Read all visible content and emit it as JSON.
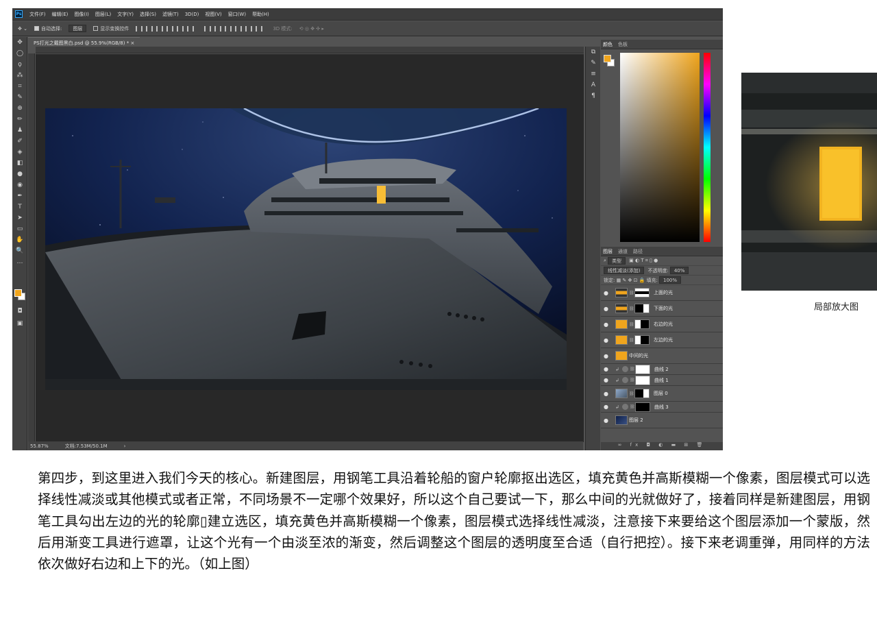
{
  "ps": {
    "menus": [
      "文件(F)",
      "编辑(E)",
      "图像(I)",
      "图层(L)",
      "文字(Y)",
      "选择(S)",
      "滤镜(T)",
      "3D(D)",
      "视图(V)",
      "窗口(W)",
      "帮助(H)"
    ],
    "options": {
      "auto_select_label": "自动选择:",
      "auto_select_value": "图层",
      "show_transform_label": "显示变换控件",
      "mode_3d_label": "3D 模式:"
    },
    "tools": [
      "✥",
      "◯",
      "ϙ",
      "⁂",
      "⌗",
      "✎",
      "⊕",
      "✏",
      "♟",
      "✐",
      "◈",
      "◧",
      "●",
      "◉",
      "✒",
      "T",
      "➤",
      "▭",
      "✋",
      "🔍",
      "…"
    ],
    "doc_tab": "PS打光之戴图黑白.psd @ 55.9%(RGB/8) *",
    "status": {
      "zoom": "55.87%",
      "doc": "文档:7.53M/50.1M"
    },
    "color_panel": {
      "tabs": [
        "颜色",
        "色板"
      ],
      "fg": "#f0a51d",
      "bg": "#ffffff"
    },
    "layers_panel": {
      "tabs": [
        "图层",
        "通道",
        "路径"
      ],
      "filter_kind": "类型",
      "blend_mode": "线性减淡(添加)",
      "opacity_label": "不透明度:",
      "opacity_value": "40%",
      "lock_label": "锁定:",
      "fill_label": "填充:",
      "fill_value": "100%",
      "layers": [
        {
          "name": "上面的光",
          "thumb": "strip",
          "mask": "bar",
          "kind": "normal"
        },
        {
          "name": "下面的光",
          "thumb": "strip",
          "mask": "dark",
          "kind": "normal"
        },
        {
          "name": "右边的光",
          "thumb": "yellow",
          "mask": "darkr",
          "kind": "normal"
        },
        {
          "name": "左边的光",
          "thumb": "yellow",
          "mask": "darkr",
          "kind": "normal"
        },
        {
          "name": "中间的光",
          "thumb": "yellow",
          "mask": "",
          "kind": "normal"
        },
        {
          "name": "曲线 2",
          "thumb": "adj",
          "mask": "white",
          "kind": "adj"
        },
        {
          "name": "曲线 1",
          "thumb": "adj",
          "mask": "white",
          "kind": "adj"
        },
        {
          "name": "图层 0",
          "thumb": "ship",
          "mask": "dark",
          "kind": "normal"
        },
        {
          "name": "曲线 3",
          "thumb": "adj",
          "mask": "black",
          "kind": "adj"
        },
        {
          "name": "图层 2",
          "thumb": "scene",
          "mask": "",
          "kind": "normal"
        }
      ]
    }
  },
  "caption": "局部放大图",
  "body_text": "第四步，到这里进入我们今天的核心。新建图层，用钢笔工具沿着轮船的窗户轮廓抠出选区，填充黄色并高斯模糊一个像素，图层模式可以选择线性减淡或其他模式或者正常，不同场景不一定哪个效果好，所以这个自己要试一下，那么中间的光就做好了，接着同样是新建图层，用钢笔工具勾出左边的光的轮廓▯建立选区，填充黄色并高斯模糊一个像素，图层模式选择线性减淡，注意接下来要给这个图层添加一个蒙版，然后用渐变工具进行遮罩，让这个光有一个由淡至浓的渐变，然后调整这个图层的透明度至合适（自行把控）。接下来老调重弹，用同样的方法依次做好右边和上下的光。（如上图）",
  "colors": {
    "accent": "#f0a51d",
    "ui_dark": "#535353",
    "night_sky": "#0e1a3d"
  }
}
